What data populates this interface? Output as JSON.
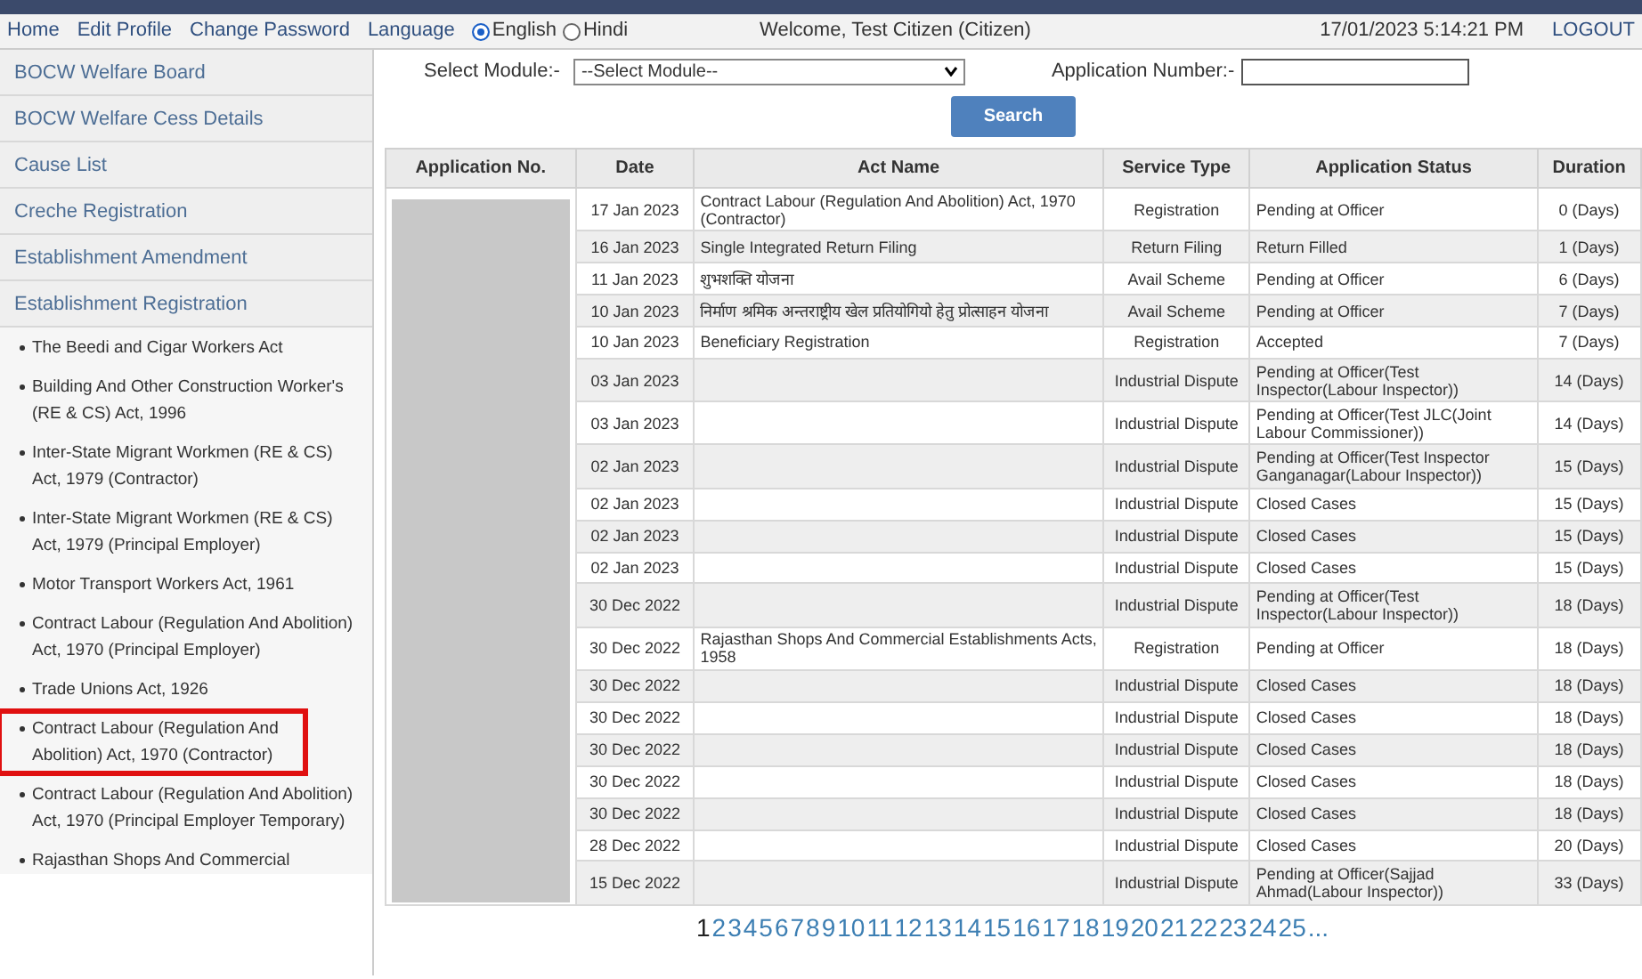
{
  "top_menu": [
    {
      "label": "Home"
    },
    {
      "label": "Edit Profile"
    },
    {
      "label": "Change Password"
    },
    {
      "label": "Language"
    }
  ],
  "language_options": [
    {
      "label": "English",
      "selected": true
    },
    {
      "label": "Hindi",
      "selected": false
    }
  ],
  "welcome": "Welcome, Test Citizen (Citizen)",
  "datetime": "17/01/2023 5:14:21 PM",
  "logout": "LOGOUT",
  "sidebar": {
    "sections": [
      {
        "label": "BOCW Welfare Board"
      },
      {
        "label": "BOCW Welfare Cess Details"
      },
      {
        "label": "Cause List"
      },
      {
        "label": "Creche Registration"
      },
      {
        "label": "Establishment Amendment"
      },
      {
        "label": "Establishment Registration"
      }
    ],
    "items": [
      {
        "label": "The Beedi and Cigar Workers Act",
        "highlighted": false
      },
      {
        "label": "Building And Other Construction Worker's (RE & CS) Act, 1996",
        "highlighted": false
      },
      {
        "label": "Inter-State Migrant Workmen (RE & CS) Act, 1979 (Contractor)",
        "highlighted": false
      },
      {
        "label": "Inter-State Migrant Workmen (RE & CS) Act, 1979 (Principal Employer)",
        "highlighted": false
      },
      {
        "label": "Motor Transport Workers Act, 1961",
        "highlighted": false
      },
      {
        "label": "Contract Labour (Regulation And Abolition) Act, 1970 (Principal Employer)",
        "highlighted": false
      },
      {
        "label": "Trade Unions Act, 1926",
        "highlighted": false
      },
      {
        "label": "Contract Labour (Regulation And Abolition) Act, 1970 (Contractor)",
        "highlighted": true
      },
      {
        "label": "Contract Labour (Regulation And Abolition) Act, 1970 (Principal Employer Temporary)",
        "highlighted": false
      },
      {
        "label": "Rajasthan Shops And Commercial",
        "highlighted": false
      }
    ]
  },
  "filters": {
    "module_label": "Select Module:-",
    "module_value": "--Select Module--",
    "app_number_label": "Application Number:-",
    "search_button": "Search"
  },
  "table": {
    "columns": [
      "Application No.",
      "Date",
      "Act Name",
      "Service Type",
      "Application Status",
      "Duration"
    ],
    "rows": [
      {
        "date": "17 Jan 2023",
        "act": "Contract Labour (Regulation And Abolition) Act, 1970 (Contractor)",
        "service": "Registration",
        "status": "Pending at Officer",
        "duration": "0 (Days)"
      },
      {
        "date": "16 Jan 2023",
        "act": "Single Integrated Return Filing",
        "service": "Return Filing",
        "status": "Return Filled",
        "duration": "1 (Days)"
      },
      {
        "date": "11 Jan 2023",
        "act": "शुभशक्ति योजना",
        "service": "Avail Scheme",
        "status": "Pending at Officer",
        "duration": "6 (Days)"
      },
      {
        "date": "10 Jan 2023",
        "act": "निर्माण श्रमिक अन्तराष्ट्रीय खेल प्रतियोगियो हेतु प्रोत्साहन योजना",
        "service": "Avail Scheme",
        "status": "Pending at Officer",
        "duration": "7 (Days)"
      },
      {
        "date": "10 Jan 2023",
        "act": "Beneficiary Registration",
        "service": "Registration",
        "status": "Accepted",
        "duration": "7 (Days)"
      },
      {
        "date": "03 Jan 2023",
        "service": "Industrial Dispute",
        "status": "Pending at Officer(Test Inspector(Labour Inspector))",
        "duration": "14 (Days)"
      },
      {
        "date": "03 Jan 2023",
        "service": "Industrial Dispute",
        "status": "Pending at Officer(Test JLC(Joint Labour Commissioner))",
        "duration": "14 (Days)"
      },
      {
        "date": "02 Jan 2023",
        "service": "Industrial Dispute",
        "status": "Pending at Officer(Test Inspector Ganganagar(Labour Inspector))",
        "duration": "15 (Days)"
      },
      {
        "date": "02 Jan 2023",
        "service": "Industrial Dispute",
        "status": "Closed Cases",
        "duration": "15 (Days)"
      },
      {
        "date": "02 Jan 2023",
        "service": "Industrial Dispute",
        "status": "Closed Cases",
        "duration": "15 (Days)"
      },
      {
        "date": "02 Jan 2023",
        "service": "Industrial Dispute",
        "status": "Closed Cases",
        "duration": "15 (Days)"
      },
      {
        "date": "30 Dec 2022",
        "service": "Industrial Dispute",
        "status": "Pending at Officer(Test Inspector(Labour Inspector))",
        "duration": "18 (Days)"
      },
      {
        "date": "30 Dec 2022",
        "act": "Rajasthan Shops And Commercial Establishments Acts, 1958",
        "service": "Registration",
        "status": "Pending at Officer",
        "duration": "18 (Days)"
      },
      {
        "date": "30 Dec 2022",
        "service": "Industrial Dispute",
        "status": "Closed Cases",
        "duration": "18 (Days)"
      },
      {
        "date": "30 Dec 2022",
        "service": "Industrial Dispute",
        "status": "Closed Cases",
        "duration": "18 (Days)"
      },
      {
        "date": "30 Dec 2022",
        "service": "Industrial Dispute",
        "status": "Closed Cases",
        "duration": "18 (Days)"
      },
      {
        "date": "30 Dec 2022",
        "service": "Industrial Dispute",
        "status": "Closed Cases",
        "duration": "18 (Days)"
      },
      {
        "date": "30 Dec 2022",
        "service": "Industrial Dispute",
        "status": "Closed Cases",
        "duration": "18 (Days)"
      },
      {
        "date": "28 Dec 2022",
        "service": "Industrial Dispute",
        "status": "Closed Cases",
        "duration": "20 (Days)"
      },
      {
        "date": "15 Dec 2022",
        "service": "Industrial Dispute",
        "status": "Pending at Officer(Sajjad Ahmad(Labour Inspector))",
        "duration": "33 (Days)"
      }
    ]
  },
  "pagination": [
    {
      "label": "1",
      "selected": true
    },
    {
      "label": "2",
      "selected": false
    },
    {
      "label": "3",
      "selected": false
    },
    {
      "label": "4",
      "selected": false
    },
    {
      "label": "5",
      "selected": false
    },
    {
      "label": "6",
      "selected": false
    },
    {
      "label": "7",
      "selected": false
    },
    {
      "label": "8",
      "selected": false
    },
    {
      "label": "9",
      "selected": false
    },
    {
      "label": "10",
      "selected": false
    },
    {
      "label": "11",
      "selected": false
    },
    {
      "label": "12",
      "selected": false
    },
    {
      "label": "13",
      "selected": false
    },
    {
      "label": "14",
      "selected": false
    },
    {
      "label": "15",
      "selected": false
    },
    {
      "label": "16",
      "selected": false
    },
    {
      "label": "17",
      "selected": false
    },
    {
      "label": "18",
      "selected": false
    },
    {
      "label": "19",
      "selected": false
    },
    {
      "label": "20",
      "selected": false
    },
    {
      "label": "21",
      "selected": false
    },
    {
      "label": "22",
      "selected": false
    },
    {
      "label": "23",
      "selected": false
    },
    {
      "label": "24",
      "selected": false
    },
    {
      "label": "25",
      "selected": false
    },
    {
      "label": "...",
      "selected": false
    }
  ]
}
